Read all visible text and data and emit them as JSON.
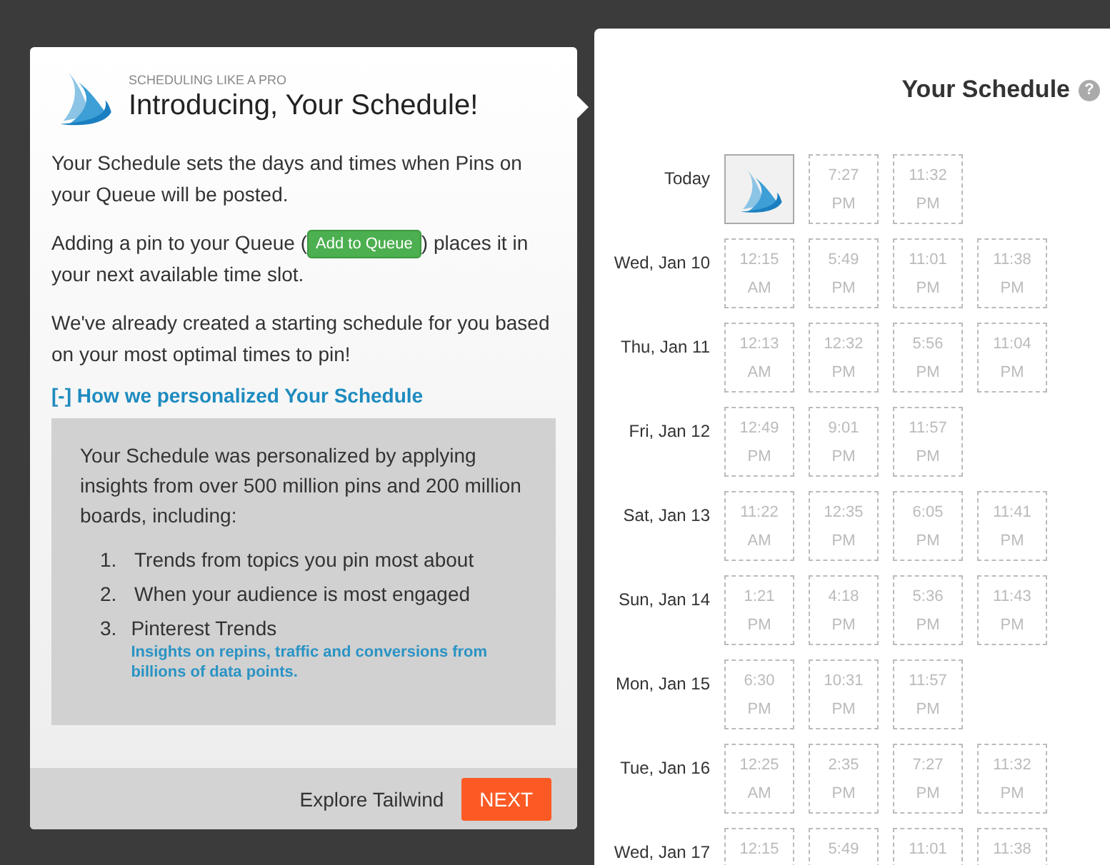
{
  "tour": {
    "eyebrow": "SCHEDULING LIKE A PRO",
    "title": "Introducing, Your Schedule!",
    "paragraphs": [
      {
        "kind": "text",
        "text": "Your Schedule sets the days and times when Pins on your Queue will be posted."
      },
      {
        "kind": "inline_button",
        "before": "Adding a pin to your Queue (",
        "button": "Add to Queue",
        "after": ") places it in your next available time slot."
      },
      {
        "kind": "text",
        "text": "We've already created a starting schedule for you based on your most optimal times to pin!"
      }
    ],
    "toggle": {
      "label": "[-] How we personalized Your Schedule"
    },
    "details": {
      "intro": "Your Schedule was personalized by applying insights from over 500 million pins and 200 million boards, including:",
      "items": [
        {
          "number": "1.",
          "text": "Trends from topics you pin most about"
        },
        {
          "number": "2.",
          "text": "When your audience is most engaged"
        },
        {
          "number": "3.",
          "text": "Pinterest Trends",
          "note": "Insights on repins, traffic and conversions from billions of data points."
        }
      ]
    },
    "footer": {
      "link": "Explore Tailwind",
      "next": "NEXT"
    }
  },
  "schedule": {
    "title": "Your Schedule",
    "help": "?",
    "days": [
      {
        "label": "Today",
        "slots": [
          {
            "kind": "pin"
          },
          {
            "kind": "empty",
            "time": "7:27",
            "meridiem": "PM"
          },
          {
            "kind": "empty",
            "time": "11:32",
            "meridiem": "PM"
          }
        ]
      },
      {
        "label": "Wed, Jan 10",
        "slots": [
          {
            "kind": "empty",
            "time": "12:15",
            "meridiem": "AM"
          },
          {
            "kind": "empty",
            "time": "5:49",
            "meridiem": "PM"
          },
          {
            "kind": "empty",
            "time": "11:01",
            "meridiem": "PM"
          },
          {
            "kind": "empty",
            "time": "11:38",
            "meridiem": "PM"
          }
        ]
      },
      {
        "label": "Thu, Jan 11",
        "slots": [
          {
            "kind": "empty",
            "time": "12:13",
            "meridiem": "AM"
          },
          {
            "kind": "empty",
            "time": "12:32",
            "meridiem": "PM"
          },
          {
            "kind": "empty",
            "time": "5:56",
            "meridiem": "PM"
          },
          {
            "kind": "empty",
            "time": "11:04",
            "meridiem": "PM"
          }
        ]
      },
      {
        "label": "Fri, Jan 12",
        "slots": [
          {
            "kind": "empty",
            "time": "12:49",
            "meridiem": "PM"
          },
          {
            "kind": "empty",
            "time": "9:01",
            "meridiem": "PM"
          },
          {
            "kind": "empty",
            "time": "11:57",
            "meridiem": "PM"
          }
        ]
      },
      {
        "label": "Sat, Jan 13",
        "slots": [
          {
            "kind": "empty",
            "time": "11:22",
            "meridiem": "AM"
          },
          {
            "kind": "empty",
            "time": "12:35",
            "meridiem": "PM"
          },
          {
            "kind": "empty",
            "time": "6:05",
            "meridiem": "PM"
          },
          {
            "kind": "empty",
            "time": "11:41",
            "meridiem": "PM"
          }
        ]
      },
      {
        "label": "Sun, Jan 14",
        "slots": [
          {
            "kind": "empty",
            "time": "1:21",
            "meridiem": "PM"
          },
          {
            "kind": "empty",
            "time": "4:18",
            "meridiem": "PM"
          },
          {
            "kind": "empty",
            "time": "5:36",
            "meridiem": "PM"
          },
          {
            "kind": "empty",
            "time": "11:43",
            "meridiem": "PM"
          }
        ]
      },
      {
        "label": "Mon, Jan 15",
        "slots": [
          {
            "kind": "empty",
            "time": "6:30",
            "meridiem": "PM"
          },
          {
            "kind": "empty",
            "time": "10:31",
            "meridiem": "PM"
          },
          {
            "kind": "empty",
            "time": "11:57",
            "meridiem": "PM"
          }
        ]
      },
      {
        "label": "Tue, Jan 16",
        "slots": [
          {
            "kind": "empty",
            "time": "12:25",
            "meridiem": "AM"
          },
          {
            "kind": "empty",
            "time": "2:35",
            "meridiem": "PM"
          },
          {
            "kind": "empty",
            "time": "7:27",
            "meridiem": "PM"
          },
          {
            "kind": "empty",
            "time": "11:32",
            "meridiem": "PM"
          }
        ]
      },
      {
        "label": "Wed, Jan 17",
        "slots": [
          {
            "kind": "empty",
            "time": "12:15"
          },
          {
            "kind": "empty",
            "time": "5:49"
          },
          {
            "kind": "empty",
            "time": "11:01"
          },
          {
            "kind": "empty",
            "time": "11:38"
          }
        ]
      }
    ]
  }
}
